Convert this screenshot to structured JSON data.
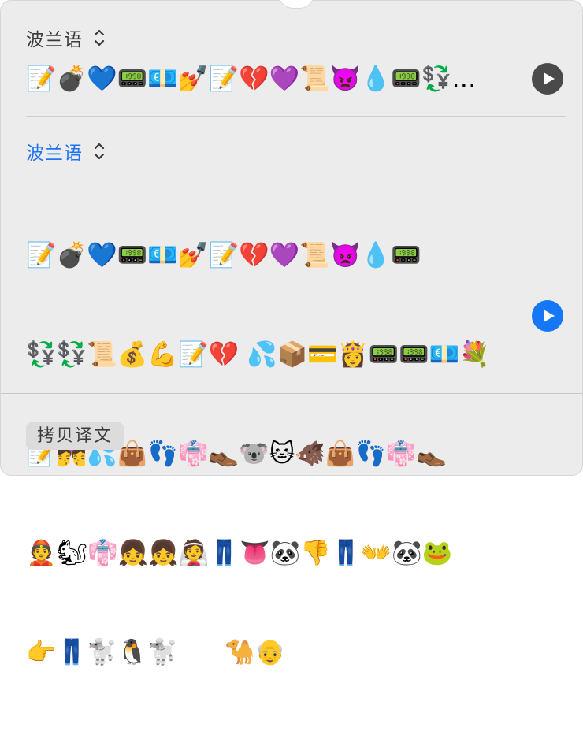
{
  "source": {
    "language": "波兰语",
    "text": "📝💣💙📟💶💅📝💔💜📜👿💧📟💱…"
  },
  "target": {
    "language": "波兰语",
    "lines": [
      "📝💣💙📟💶💅📝💔💜📜👿💧📟",
      "💱💱📜💰💪📝💔 💦📦💳👸📟📟💶💐",
      "📝💏💦👜👣👘👞🐨🐱🐗👜👣👘👞",
      "👲🐿👘👧👧👰👖👅🐼👎👖👐🐼🐸",
      "👉👖🐩🐧🐩      🐪👴"
    ]
  },
  "actions": {
    "copy_label": "拷贝译文"
  },
  "colors": {
    "accent": "#1577f5",
    "source_play": "#4a4a4a"
  }
}
